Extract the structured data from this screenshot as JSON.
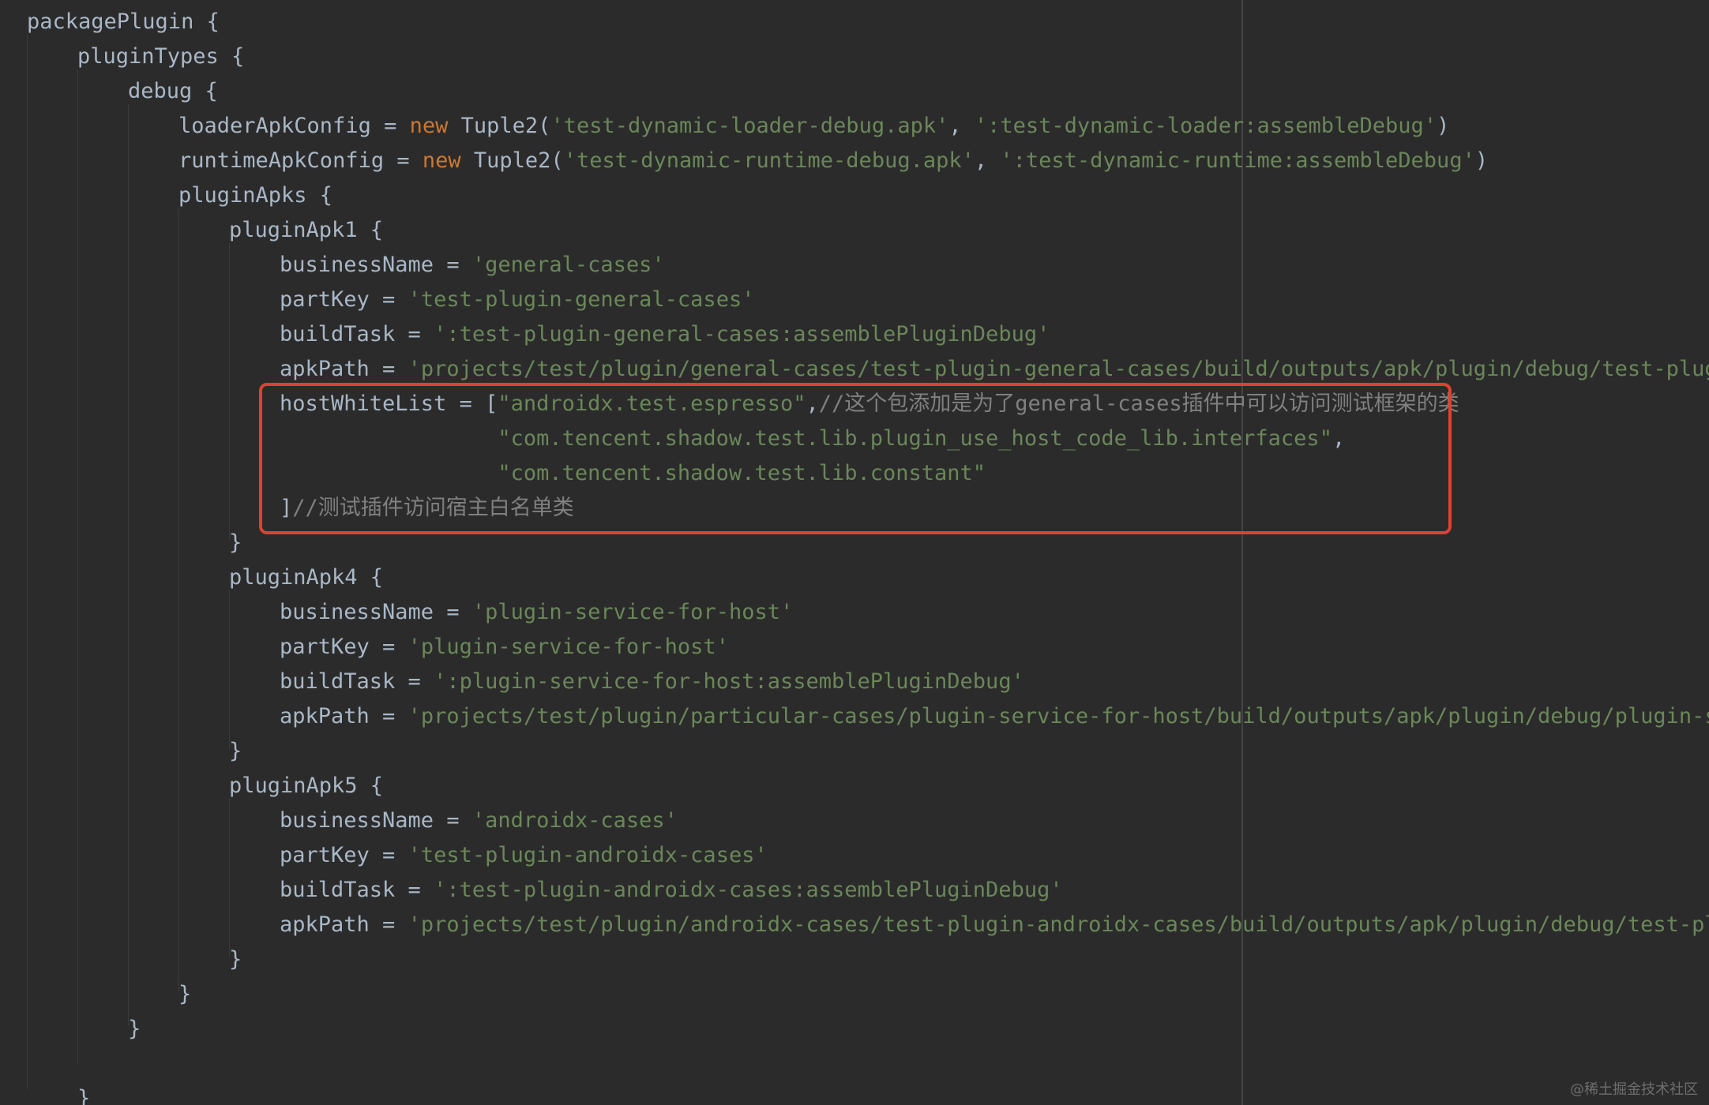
{
  "colors": {
    "background": "#2b2b2b",
    "identifier": "#a9b7c6",
    "keyword": "#cc7832",
    "string": "#6a8759",
    "comment": "#808080",
    "highlight_border": "#e0412e"
  },
  "code_lines": [
    {
      "indent": 0,
      "tokens": [
        {
          "t": "ident",
          "v": "packagePlugin {"
        }
      ]
    },
    {
      "indent": 1,
      "tokens": [
        {
          "t": "ident",
          "v": "pluginTypes {"
        }
      ]
    },
    {
      "indent": 2,
      "tokens": [
        {
          "t": "ident",
          "v": "debug {"
        }
      ]
    },
    {
      "indent": 3,
      "tokens": [
        {
          "t": "ident",
          "v": "loaderApkConfig = "
        },
        {
          "t": "kw",
          "v": "new "
        },
        {
          "t": "ident",
          "v": "Tuple2("
        },
        {
          "t": "str",
          "v": "'test-dynamic-loader-debug.apk'"
        },
        {
          "t": "ident",
          "v": ", "
        },
        {
          "t": "str",
          "v": "':test-dynamic-loader:assembleDebug'"
        },
        {
          "t": "ident",
          "v": ")"
        }
      ]
    },
    {
      "indent": 3,
      "tokens": [
        {
          "t": "ident",
          "v": "runtimeApkConfig = "
        },
        {
          "t": "kw",
          "v": "new "
        },
        {
          "t": "ident",
          "v": "Tuple2("
        },
        {
          "t": "str",
          "v": "'test-dynamic-runtime-debug.apk'"
        },
        {
          "t": "ident",
          "v": ", "
        },
        {
          "t": "str",
          "v": "':test-dynamic-runtime:assembleDebug'"
        },
        {
          "t": "ident",
          "v": ")"
        }
      ]
    },
    {
      "indent": 3,
      "tokens": [
        {
          "t": "ident",
          "v": "pluginApks {"
        }
      ]
    },
    {
      "indent": 4,
      "tokens": [
        {
          "t": "ident",
          "v": "pluginApk1 {"
        }
      ]
    },
    {
      "indent": 5,
      "tokens": [
        {
          "t": "ident",
          "v": "businessName = "
        },
        {
          "t": "str",
          "v": "'general-cases'"
        }
      ]
    },
    {
      "indent": 5,
      "tokens": [
        {
          "t": "ident",
          "v": "partKey = "
        },
        {
          "t": "str",
          "v": "'test-plugin-general-cases'"
        }
      ]
    },
    {
      "indent": 5,
      "tokens": [
        {
          "t": "ident",
          "v": "buildTask = "
        },
        {
          "t": "str",
          "v": "':test-plugin-general-cases:assemblePluginDebug'"
        }
      ]
    },
    {
      "indent": 5,
      "tokens": [
        {
          "t": "ident",
          "v": "apkPath = "
        },
        {
          "t": "str",
          "v": "'projects/test/plugin/general-cases/test-plugin-general-cases/build/outputs/apk/plugin/debug/test-plugi"
        }
      ]
    },
    {
      "indent": 5,
      "tokens": [
        {
          "t": "ident",
          "v": "hostWhiteList = ["
        },
        {
          "t": "str",
          "v": "\"androidx.test.espresso\""
        },
        {
          "t": "ident",
          "v": ","
        },
        {
          "t": "comment",
          "v": "//这个包添加是为了general-cases插件中可以访问测试框架的类"
        }
      ]
    },
    {
      "indent": 5,
      "tokens": [
        {
          "t": "ident",
          "v": "                 "
        },
        {
          "t": "str",
          "v": "\"com.tencent.shadow.test.lib.plugin_use_host_code_lib.interfaces\""
        },
        {
          "t": "ident",
          "v": ","
        }
      ]
    },
    {
      "indent": 5,
      "tokens": [
        {
          "t": "ident",
          "v": "                 "
        },
        {
          "t": "str",
          "v": "\"com.tencent.shadow.test.lib.constant\""
        }
      ]
    },
    {
      "indent": 5,
      "tokens": [
        {
          "t": "ident",
          "v": "]"
        },
        {
          "t": "comment",
          "v": "//测试插件访问宿主白名单类"
        }
      ]
    },
    {
      "indent": 4,
      "tokens": [
        {
          "t": "ident",
          "v": "}"
        }
      ]
    },
    {
      "indent": 4,
      "tokens": [
        {
          "t": "ident",
          "v": "pluginApk4 {"
        }
      ]
    },
    {
      "indent": 5,
      "tokens": [
        {
          "t": "ident",
          "v": "businessName = "
        },
        {
          "t": "str",
          "v": "'plugin-service-for-host'"
        }
      ]
    },
    {
      "indent": 5,
      "tokens": [
        {
          "t": "ident",
          "v": "partKey = "
        },
        {
          "t": "str",
          "v": "'plugin-service-for-host'"
        }
      ]
    },
    {
      "indent": 5,
      "tokens": [
        {
          "t": "ident",
          "v": "buildTask = "
        },
        {
          "t": "str",
          "v": "':plugin-service-for-host:assemblePluginDebug'"
        }
      ]
    },
    {
      "indent": 5,
      "tokens": [
        {
          "t": "ident",
          "v": "apkPath = "
        },
        {
          "t": "str",
          "v": "'projects/test/plugin/particular-cases/plugin-service-for-host/build/outputs/apk/plugin/debug/plugin-se"
        }
      ]
    },
    {
      "indent": 4,
      "tokens": [
        {
          "t": "ident",
          "v": "}"
        }
      ]
    },
    {
      "indent": 4,
      "tokens": [
        {
          "t": "ident",
          "v": "pluginApk5 {"
        }
      ]
    },
    {
      "indent": 5,
      "tokens": [
        {
          "t": "ident",
          "v": "businessName = "
        },
        {
          "t": "str",
          "v": "'androidx-cases'"
        }
      ]
    },
    {
      "indent": 5,
      "tokens": [
        {
          "t": "ident",
          "v": "partKey = "
        },
        {
          "t": "str",
          "v": "'test-plugin-androidx-cases'"
        }
      ]
    },
    {
      "indent": 5,
      "tokens": [
        {
          "t": "ident",
          "v": "buildTask = "
        },
        {
          "t": "str",
          "v": "':test-plugin-androidx-cases:assemblePluginDebug'"
        }
      ]
    },
    {
      "indent": 5,
      "tokens": [
        {
          "t": "ident",
          "v": "apkPath = "
        },
        {
          "t": "str",
          "v": "'projects/test/plugin/androidx-cases/test-plugin-androidx-cases/build/outputs/apk/plugin/debug/test-plu"
        }
      ]
    },
    {
      "indent": 4,
      "tokens": [
        {
          "t": "ident",
          "v": "}"
        }
      ]
    },
    {
      "indent": 3,
      "tokens": [
        {
          "t": "ident",
          "v": "}"
        }
      ]
    },
    {
      "indent": 2,
      "tokens": [
        {
          "t": "ident",
          "v": "}"
        }
      ]
    },
    {
      "indent": 0,
      "tokens": []
    },
    {
      "indent": 1,
      "tokens": [
        {
          "t": "ident",
          "v": "}"
        }
      ]
    }
  ],
  "watermark": "@稀土掘金技术社区"
}
